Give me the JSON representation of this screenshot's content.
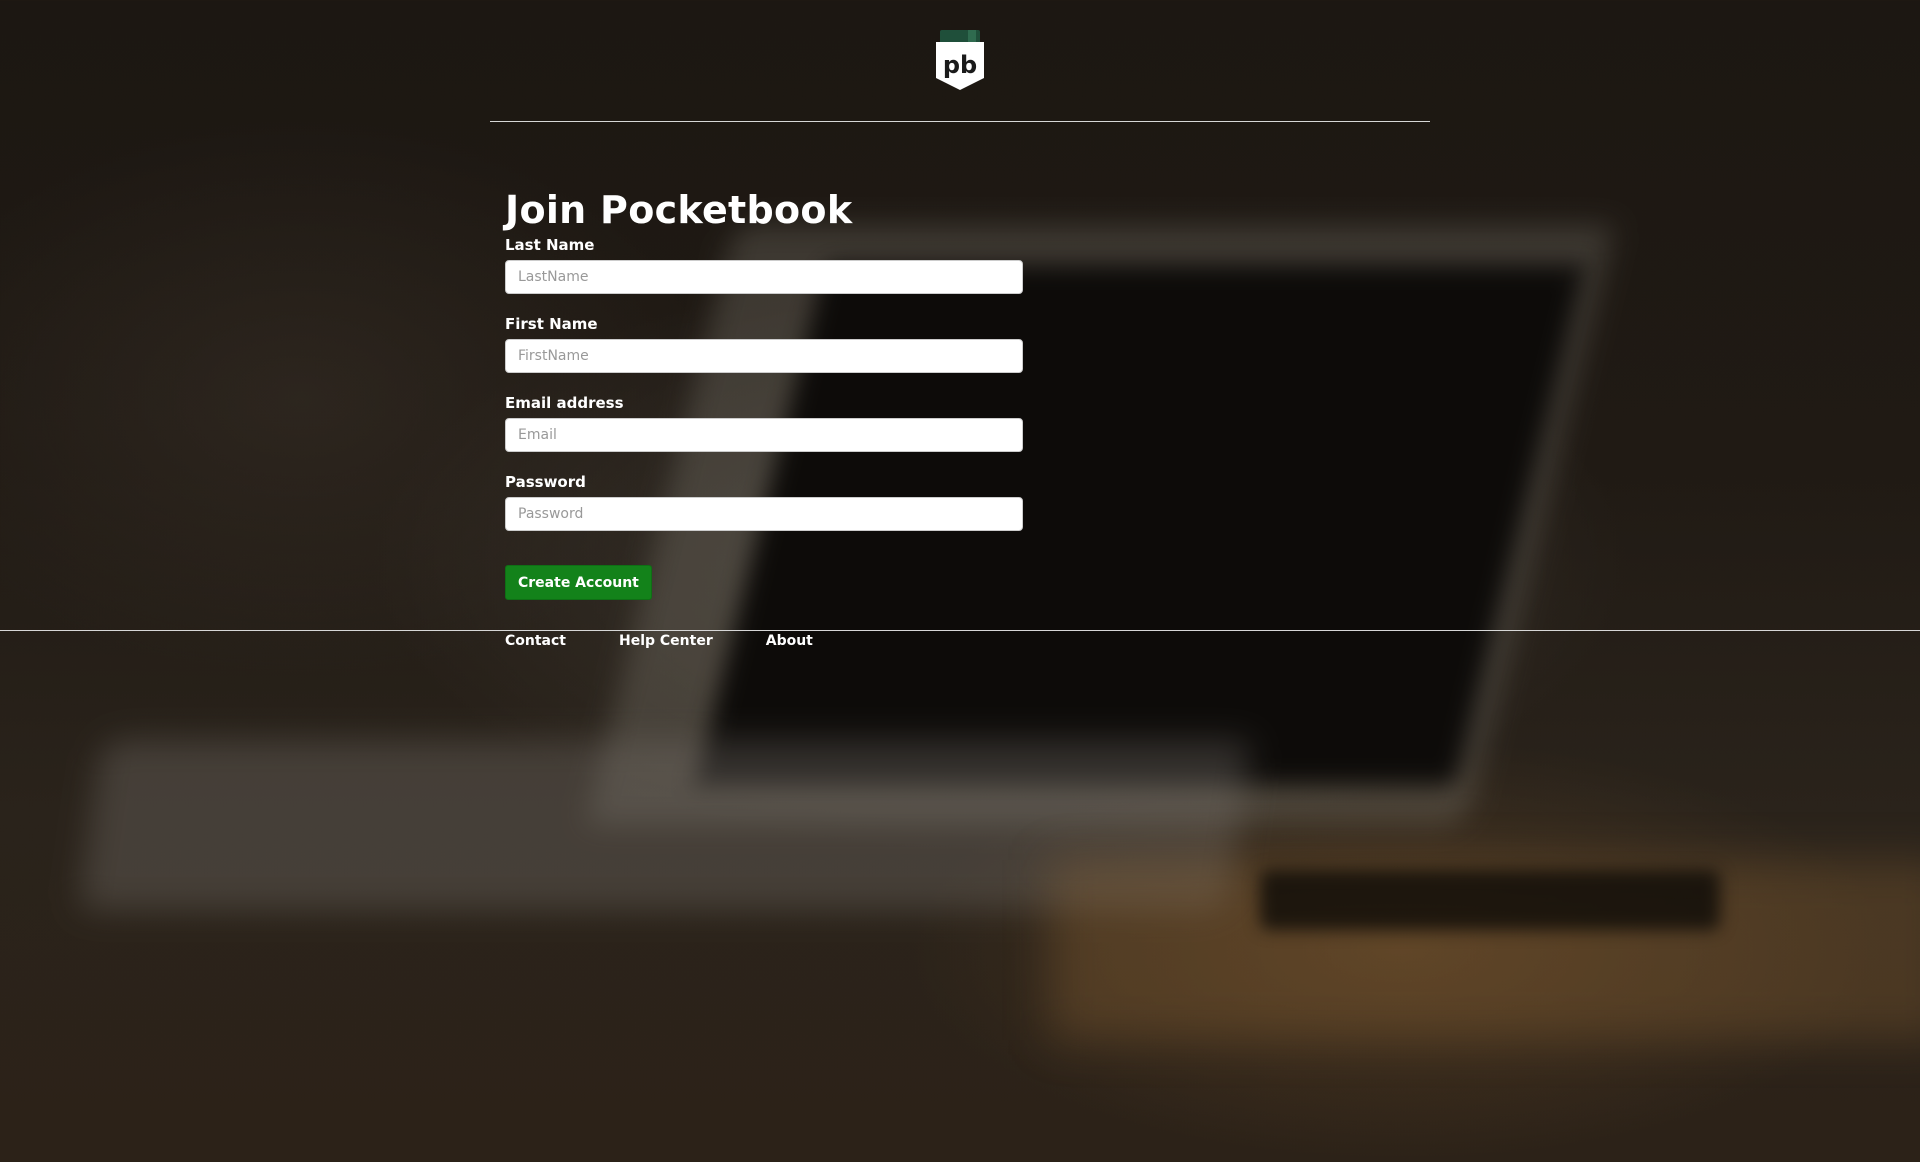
{
  "brand": {
    "logo_text": "pb",
    "logo_color": "#ffffff",
    "logo_tab_color": "#1f4f3a"
  },
  "form": {
    "title": "Join Pocketbook",
    "fields": [
      {
        "label": "Last Name",
        "placeholder": "LastName",
        "value": ""
      },
      {
        "label": "First Name",
        "placeholder": "FirstName",
        "value": ""
      },
      {
        "label": "Email address",
        "placeholder": "Email",
        "value": ""
      },
      {
        "label": "Password",
        "placeholder": "Password",
        "value": ""
      }
    ],
    "submit_label": "Create Account",
    "submit_color": "#13821a"
  },
  "footer": {
    "links": [
      {
        "label": "Contact"
      },
      {
        "label": "Help Center"
      },
      {
        "label": "About"
      }
    ]
  }
}
